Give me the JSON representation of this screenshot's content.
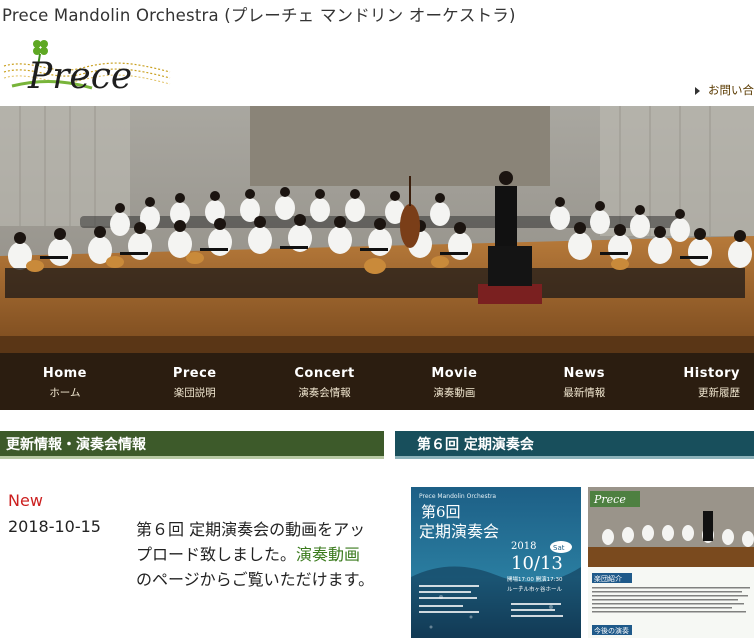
{
  "header": {
    "site_title": "Prece Mandolin Orchestra (プレーチェ マンドリン オーケストラ)",
    "logo_text": "Prece",
    "contact_label": "お問い合"
  },
  "nav": [
    {
      "en": "Home",
      "jp": "ホーム"
    },
    {
      "en": "Prece",
      "jp": "楽団説明"
    },
    {
      "en": "Concert",
      "jp": "演奏会情報"
    },
    {
      "en": "Movie",
      "jp": "演奏動画"
    },
    {
      "en": "News",
      "jp": "最新情報"
    },
    {
      "en": "History",
      "jp": "更新履歴"
    }
  ],
  "news_section": {
    "heading": "更新情報・演奏会情報",
    "badge": "New",
    "date": "2018-10-15",
    "text_before": "第６回 定期演奏会の動画をアップロード致しました。",
    "link": "演奏動画",
    "text_after": "のページからご覧いただけます。"
  },
  "concert_section": {
    "heading": "第６回 定期演奏会",
    "poster": {
      "org": "Prece Mandolin Orchestra",
      "title_line1": "第6回",
      "title_line2": "定期演奏会",
      "year": "2018",
      "date": "10/13",
      "weekday": "Sat",
      "times": "開場17:00 開演17:30",
      "venue": "ルーテル市ヶ谷ホール"
    },
    "flyer": {
      "logo": "Prece",
      "section": "楽団紹介",
      "bottom": "今後の演奏"
    }
  },
  "colors": {
    "nav_bg": "#2b1d10",
    "news_heading_bg": "#3d5a2a",
    "concert_heading_bg": "#184f5c",
    "new_badge": "#cc1f1f",
    "link": "#3a7a1c"
  }
}
